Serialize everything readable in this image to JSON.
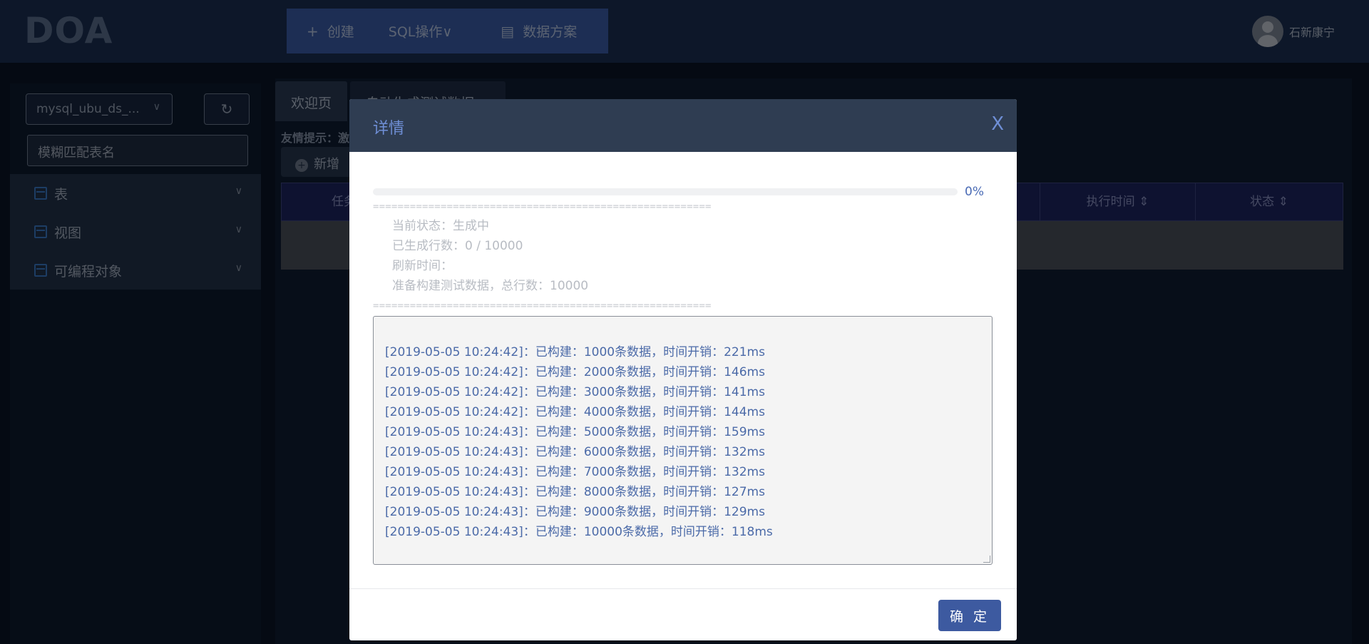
{
  "app": {
    "logo": "DOA",
    "menu": [
      {
        "icon": "plus-icon",
        "glyph": "+",
        "label": "创建"
      },
      {
        "icon": "",
        "glyph": "",
        "label": "SQL操作∨"
      },
      {
        "icon": "document-icon",
        "glyph": "▤",
        "label": "数据方案"
      }
    ],
    "user": {
      "name": "石新康宁"
    }
  },
  "sidebar": {
    "datasource": "mysql_ubu_ds_...",
    "search_placeholder": "模糊匹配表名",
    "items": [
      {
        "label": "表"
      },
      {
        "label": "视图"
      },
      {
        "label": "可编程对象"
      }
    ]
  },
  "main": {
    "tabs": [
      {
        "label": "欢迎页"
      },
      {
        "label": "自动生成测试数据 ×"
      }
    ],
    "hint": "友情提示：激",
    "add_button": "新增",
    "table_headers": [
      "任务",
      "执行时间 ⇕",
      "状态 ⇕"
    ]
  },
  "modal": {
    "title": "详情",
    "close": "X",
    "progress": {
      "percent": 0,
      "label": "0%"
    },
    "divider": "=======================================================",
    "status": {
      "current": "当前状态：生成中",
      "generated": "已生成行数：0 / 10000",
      "refresh": "刷新时间：",
      "prepare": "准备构建测试数据，总行数：10000"
    },
    "log": [
      "[2019-05-05 10:24:42]：已构建：1000条数据，时间开销：221ms",
      "[2019-05-05 10:24:42]：已构建：2000条数据，时间开销：146ms",
      "[2019-05-05 10:24:42]：已构建：3000条数据，时间开销：141ms",
      "[2019-05-05 10:24:42]：已构建：4000条数据，时间开销：144ms",
      "[2019-05-05 10:24:43]：已构建：5000条数据，时间开销：159ms",
      "[2019-05-05 10:24:43]：已构建：6000条数据，时间开销：132ms",
      "[2019-05-05 10:24:43]：已构建：7000条数据，时间开销：132ms",
      "[2019-05-05 10:24:43]：已构建：8000条数据，时间开销：127ms",
      "[2019-05-05 10:24:43]：已构建：9000条数据，时间开销：129ms",
      "[2019-05-05 10:24:43]：已构建：10000条数据，时间开销：118ms"
    ],
    "ok_label": "确 定"
  },
  "colors": {
    "accent": "#3d5aa0",
    "header": "#2f3d52",
    "log_text": "#4b6aa8"
  }
}
